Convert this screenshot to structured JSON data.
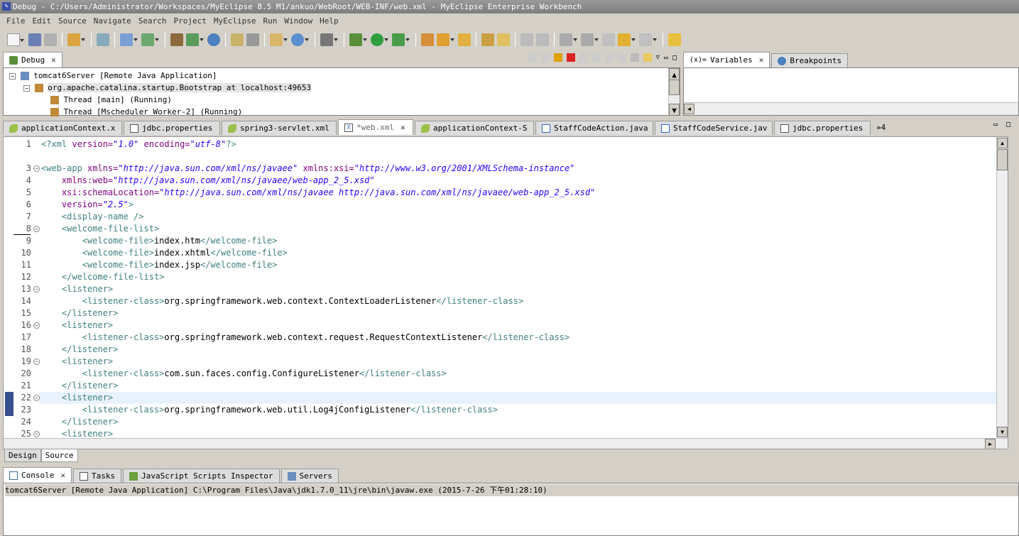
{
  "window": {
    "title": "Debug - C:/Users/Administrator/Workspaces/MyEclipse 8.5 M1/ankuo/WebRoot/WEB-INF/web.xml - MyEclipse Enterprise Workbench"
  },
  "menu": [
    "File",
    "Edit",
    "Source",
    "Navigate",
    "Search",
    "Project",
    "MyEclipse",
    "Run",
    "Window",
    "Help"
  ],
  "debug_view": {
    "tab_label": "Debug",
    "tree": [
      "tomcat6Server [Remote Java Application]",
      "org.apache.catalina.startup.Bootstrap at localhost:49653",
      "Thread [main] (Running)",
      "Thread [Mscheduler Worker-2] (Running)"
    ]
  },
  "side_tabs": {
    "variables": "Variables",
    "breakpoints": "Breakpoints"
  },
  "editor_tabs": [
    {
      "label": "applicationContext.x",
      "icon": "spring-xml-icon"
    },
    {
      "label": "jdbc.properties",
      "icon": "properties-file-icon"
    },
    {
      "label": "spring3-servlet.xml",
      "icon": "spring-xml-icon"
    },
    {
      "label": "*web.xml",
      "icon": "xml-file-icon",
      "active": true
    },
    {
      "label": "applicationContext-S",
      "icon": "spring-xml-icon"
    },
    {
      "label": "StaffCodeAction.java",
      "icon": "java-file-icon"
    },
    {
      "label": "StaffCodeService.jav",
      "icon": "java-file-icon"
    },
    {
      "label": "jdbc.properties",
      "icon": "properties-file-icon"
    }
  ],
  "editor_overflow": "»4",
  "code_lines": [
    {
      "n": "1",
      "fold": false
    },
    {
      "n": "",
      "fold": false
    },
    {
      "n": "3",
      "fold": true
    },
    {
      "n": "4",
      "fold": false
    },
    {
      "n": "5",
      "fold": false
    },
    {
      "n": "6",
      "fold": false
    },
    {
      "n": "7",
      "fold": false
    },
    {
      "n": "8",
      "fold": true
    },
    {
      "n": "9",
      "fold": false
    },
    {
      "n": "10",
      "fold": false
    },
    {
      "n": "11",
      "fold": false
    },
    {
      "n": "12",
      "fold": false
    },
    {
      "n": "13",
      "fold": true
    },
    {
      "n": "14",
      "fold": false
    },
    {
      "n": "15",
      "fold": false
    },
    {
      "n": "16",
      "fold": true
    },
    {
      "n": "17",
      "fold": false
    },
    {
      "n": "18",
      "fold": false
    },
    {
      "n": "19",
      "fold": true
    },
    {
      "n": "20",
      "fold": false
    },
    {
      "n": "21",
      "fold": false
    },
    {
      "n": "22",
      "fold": true
    },
    {
      "n": "23",
      "fold": false
    },
    {
      "n": "24",
      "fold": false
    },
    {
      "n": "25",
      "fold": true
    }
  ],
  "code": {
    "l1_pi": "<?xml ",
    "l1_a1": "version=",
    "l1_v1": "\"1.0\"",
    "l1_a2": " encoding=",
    "l1_v2": "\"utf-8\"",
    "l1_end": "?>",
    "l3_tag": "<web-app ",
    "l3_a1": "xmlns=",
    "l3_v1": "\"http://java.sun.com/xml/ns/javaee\"",
    "l3_a2": " xmlns:xsi=",
    "l3_v2": "\"http://www.w3.org/2001/XMLSchema-instance\"",
    "l4_a": "xmlns:web=",
    "l4_v": "\"http://java.sun.com/xml/ns/javaee/web-app_2_5.xsd\"",
    "l5_a": "xsi:schemaLocation=",
    "l5_v": "\"http://java.sun.com/xml/ns/javaee http://java.sun.com/xml/ns/javaee/web-app_2_5.xsd\"",
    "l6_a": "version=",
    "l6_v": "\"2.5\"",
    "l6_end": ">",
    "l7": "<display-name />",
    "l8": "<welcome-file-list>",
    "wf_open": "<welcome-file>",
    "wf_close": "</welcome-file>",
    "l9": "index.htm",
    "l10": "index.xhtml",
    "l11": "index.jsp",
    "l12": "</welcome-file-list>",
    "lst_open": "<listener>",
    "lst_close": "</listener>",
    "lc_open": "<listener-class>",
    "lc_close": "</listener-class>",
    "l14": "org.springframework.web.context.ContextLoaderListener",
    "l17": "org.springframework.web.context.request.RequestContextListener",
    "l20": "com.sun.faces.config.ConfigureListener",
    "l23": "org.springframework.web.util.Log4jConfigListener"
  },
  "editor_bottom_tabs": [
    "Design",
    "Source"
  ],
  "bottom_tabs": [
    {
      "label": "Console",
      "icon": "console-icon"
    },
    {
      "label": "Tasks",
      "icon": "tasks-icon"
    },
    {
      "label": "JavaScript Scripts Inspector",
      "icon": "js-inspector-icon"
    },
    {
      "label": "Servers",
      "icon": "servers-icon"
    }
  ],
  "console_status": "tomcat6Server [Remote Java Application] C:\\Program Files\\Java\\jdk1.7.0_11\\jre\\bin\\javaw.exe (2015-7-26 下午01:28:10)",
  "colors": {
    "tag": "#3f7f7f",
    "attr": "#7f007f",
    "value": "#2a00ff",
    "current_line": "#e8f2fe"
  }
}
